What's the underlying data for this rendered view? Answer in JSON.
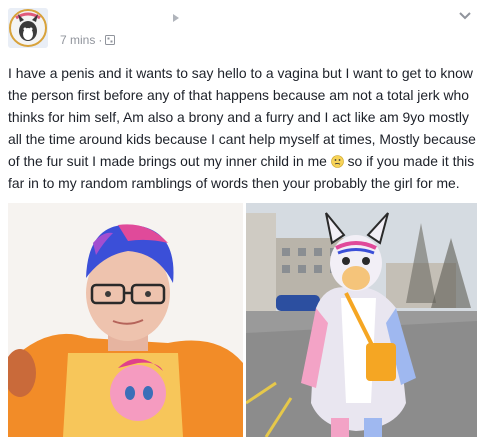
{
  "post": {
    "time": "7 mins",
    "separator": "·",
    "text_before_emoji": "I have a penis and it wants to say hello to a vagina but I want to get to know the person first before any of that happens because am not a total jerk who thinks for him self, Am also a brony and a furry and I act like am 9yo mostly all the time around kids because I cant help myself at times, Mostly because of the fur suit I made brings out my inner child in me",
    "text_after_emoji": " so if you made it this far in to my random ramblings of words then your probably the girl for me.",
    "emoji": "confused-face-emoji",
    "icons": {
      "audience": "public-globe-icon",
      "media": "play-icon",
      "menu": "chevron-down-icon"
    }
  },
  "photos": [
    {
      "name": "selfie-photo"
    },
    {
      "name": "fursuit-photo"
    }
  ],
  "colors": {
    "text": "#1d2129",
    "meta": "#90949c",
    "hair_blue": "#3b4fd8",
    "hair_pink": "#e04a9a",
    "fursuit_orange": "#f5a623"
  }
}
